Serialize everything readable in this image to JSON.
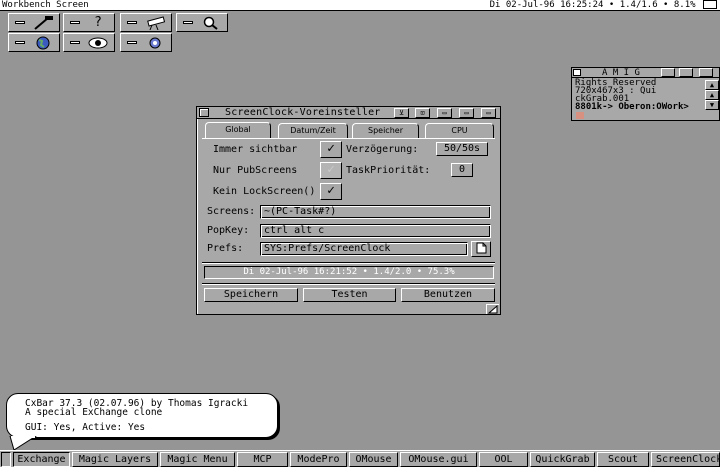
{
  "screen": {
    "title": "Workbench Screen",
    "clock": "Di 02-Jul-96 16:25:24",
    "load": "1.4/1.6",
    "percent": "8.1%"
  },
  "launchers": [
    {
      "icon": "hammer-icon",
      "glyph": "🔨"
    },
    {
      "icon": "help-icon",
      "glyph": "?"
    },
    {
      "icon": "telescope-icon",
      "glyph": "🔭"
    },
    {
      "icon": "magnifier-icon",
      "glyph": "🔍"
    },
    {
      "icon": "globe-icon",
      "glyph": "🌐"
    },
    {
      "icon": "eye-icon",
      "glyph": "👁"
    },
    {
      "icon": "gears-icon",
      "glyph": "⚙"
    }
  ],
  "window": {
    "title": "ScreenClock-Voreinsteller",
    "tabs": [
      "Global",
      "Datum/Zeit",
      "Speicher",
      "CPU"
    ],
    "active_tab": "Global",
    "labels": {
      "always_visible": "Immer sichtbar",
      "delay": "Verzögerung:",
      "pub_screens": "Nur PubScreens",
      "task_priority": "TaskPriorität:",
      "no_lockscreen": "Kein LockScreen()",
      "screens": "Screens:",
      "popkey": "PopKey:",
      "prefs": "Prefs:"
    },
    "values": {
      "delay": "50/50s",
      "task_priority": "0",
      "screens": "~(PC-Task#?)",
      "popkey": "ctrl alt c",
      "prefs": "SYS:Prefs/ScreenClock"
    },
    "checks": {
      "always_visible": "✓",
      "pub_screens": "✓",
      "no_lockscreen": "✓"
    },
    "preview": "Di 02-Jul-96 16:21:52 • 1.4/2.0 • 75.3%",
    "buttons": {
      "save": "Speichern",
      "test": "Testen",
      "use": "Benutzen"
    }
  },
  "miniwin": {
    "title": "A M I G",
    "lines": [
      "Rights Reserved",
      "720x467x3      : Qui",
      "ckGrab.001",
      "8801k-> Oberon:OWork>"
    ]
  },
  "balloon": {
    "line1": "CxBar 37.3 (02.07.96) by Thomas Igracki",
    "line2": "A special ExChange clone",
    "line3": "GUI: Yes,  Active: Yes"
  },
  "taskbar": [
    "Exchange",
    "Magic Layers",
    "Magic Menu",
    "MCP",
    "ModePro",
    "OMouse",
    "OMouse.gui",
    "OOL",
    "QuickGrab",
    "Scout",
    "ScreenClock"
  ]
}
